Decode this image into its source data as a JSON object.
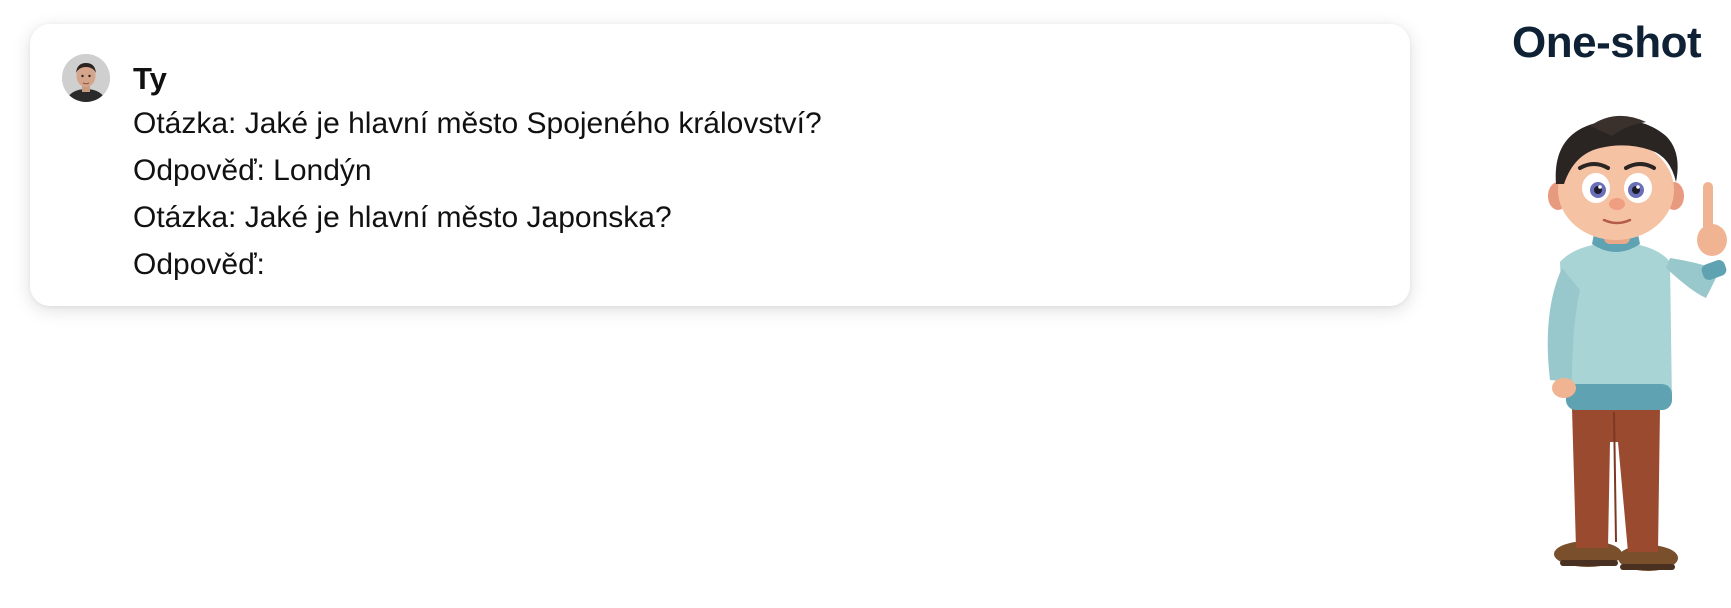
{
  "title": "One-shot",
  "message": {
    "sender": "Ty",
    "lines": [
      "Otázka: Jaké je hlavní město Spojeného království?",
      "Odpověď: Londýn",
      "Otázka: Jaké je hlavní město Japonska?",
      "Odpověď:"
    ]
  },
  "icons": {
    "avatar": "user-avatar-photo",
    "character": "cartoon-man-pointing-up"
  }
}
